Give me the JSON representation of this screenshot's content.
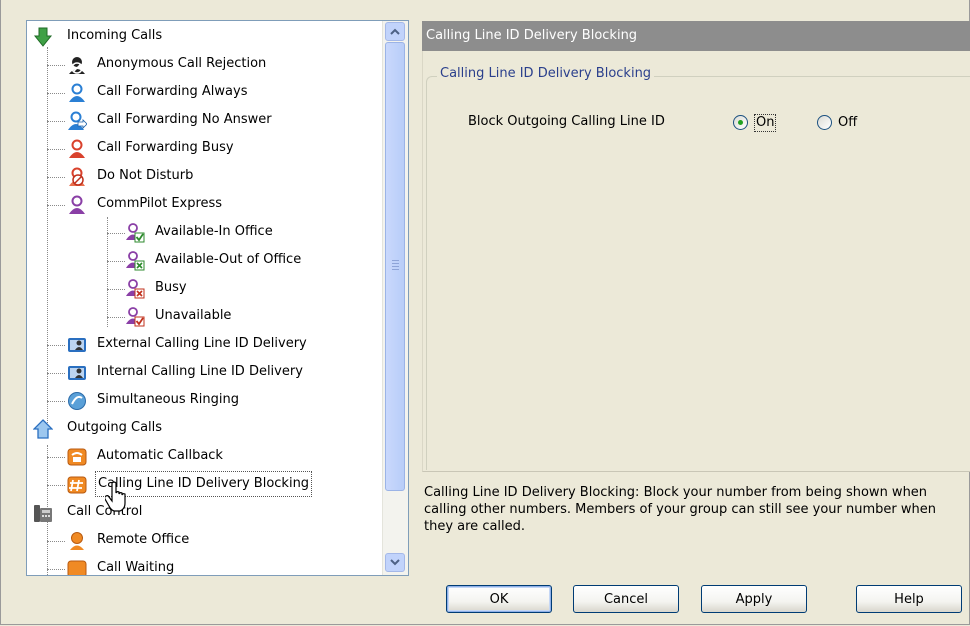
{
  "tree": {
    "nodes": [
      {
        "label": "Incoming Calls",
        "icon": "incoming-calls-icon"
      },
      {
        "label": "Anonymous Call Rejection",
        "icon": "anonymous-rejection-icon"
      },
      {
        "label": "Call Forwarding Always",
        "icon": "forwarding-always-icon"
      },
      {
        "label": "Call Forwarding No Answer",
        "icon": "forwarding-no-answer-icon"
      },
      {
        "label": "Call Forwarding Busy",
        "icon": "forwarding-busy-icon"
      },
      {
        "label": "Do Not Disturb",
        "icon": "do-not-disturb-icon"
      },
      {
        "label": "CommPilot Express",
        "icon": "commpilot-express-icon"
      },
      {
        "label": "Available-In Office",
        "icon": "available-in-office-icon"
      },
      {
        "label": "Available-Out of Office",
        "icon": "available-out-of-office-icon"
      },
      {
        "label": "Busy",
        "icon": "busy-icon"
      },
      {
        "label": "Unavailable",
        "icon": "unavailable-icon"
      },
      {
        "label": "External Calling Line ID Delivery",
        "icon": "external-clid-icon"
      },
      {
        "label": "Internal Calling Line ID Delivery",
        "icon": "internal-clid-icon"
      },
      {
        "label": "Simultaneous Ringing",
        "icon": "simultaneous-ringing-icon"
      },
      {
        "label": "Outgoing Calls",
        "icon": "outgoing-calls-icon"
      },
      {
        "label": "Automatic Callback",
        "icon": "automatic-callback-icon"
      },
      {
        "label": "Calling Line ID Delivery Blocking",
        "icon": "clid-blocking-icon"
      },
      {
        "label": "Call Control",
        "icon": "call-control-icon"
      },
      {
        "label": "Remote Office",
        "icon": "remote-office-icon"
      },
      {
        "label": "Call Waiting",
        "icon": "call-waiting-icon"
      }
    ]
  },
  "panel": {
    "title": "Calling Line ID Delivery Blocking",
    "group_title": "Calling Line ID Delivery Blocking",
    "setting_label": "Block Outgoing Calling Line ID",
    "option_on": "On",
    "option_off": "Off",
    "selected": "On",
    "description": "Calling Line ID Delivery Blocking: Block your number from being shown when calling other numbers. Members of your group can still see your number when they are called."
  },
  "buttons": {
    "ok": "OK",
    "cancel": "Cancel",
    "apply": "Apply",
    "help": "Help"
  },
  "colors": {
    "title_bar": "#8d8d8d",
    "group_title": "#2a3f8c",
    "radio_selected": "#21a121"
  }
}
